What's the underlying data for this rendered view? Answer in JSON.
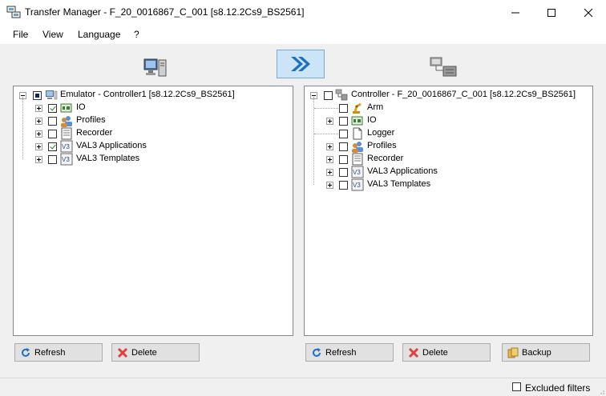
{
  "window": {
    "title": "Transfer Manager - F_20_0016867_C_001 [s8.12.2Cs9_BS2561]"
  },
  "menu": [
    "File",
    "View",
    "Language",
    "?"
  ],
  "left_tree": {
    "root": "Emulator - Controller1 [s8.12.2Cs9_BS2561]",
    "items": [
      "IO",
      "Profiles",
      "Recorder",
      "VAL3 Applications",
      "VAL3 Templates"
    ]
  },
  "right_tree": {
    "root": "Controller - F_20_0016867_C_001 [s8.12.2Cs9_BS2561]",
    "items": [
      "Arm",
      "IO",
      "Logger",
      "Profiles",
      "Recorder",
      "VAL3 Applications",
      "VAL3 Templates"
    ]
  },
  "buttons": {
    "refresh": "Refresh",
    "delete": "Delete",
    "backup": "Backup"
  },
  "status": {
    "excluded_filters": "Excluded filters"
  },
  "icons": {
    "app": "transfer-manager-icon",
    "source": "pc-icon",
    "transfer": "double-chevron-right-icon",
    "target": "controller-network-icon"
  },
  "colors": {
    "accent": "#cce4f7",
    "transfer_arrow": "#1f6fc5",
    "delete_icon": "#e04040"
  }
}
